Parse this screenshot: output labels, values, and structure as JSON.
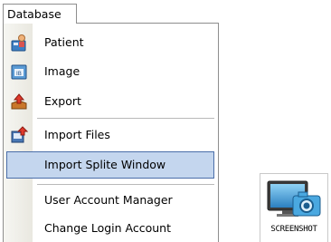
{
  "menu": {
    "title": "Database",
    "items": [
      {
        "label": "Patient",
        "icon": "patient-icon"
      },
      {
        "label": "Image",
        "icon": "image-icon"
      },
      {
        "label": "Export",
        "icon": "export-icon"
      },
      {
        "label": "Import Files",
        "icon": "import-files-icon"
      },
      {
        "label": "Import Splite Window"
      },
      {
        "label": "User Account Manager"
      },
      {
        "label": "Change Login Account"
      }
    ],
    "highlight_item": "Import Splite Window"
  },
  "desktop_icon": {
    "caption": "SCREENSHOT",
    "icon": "screenshot-camera-icon"
  },
  "colors": {
    "highlight_bg": "#c4d6ee",
    "highlight_border": "#4a6ea9"
  }
}
